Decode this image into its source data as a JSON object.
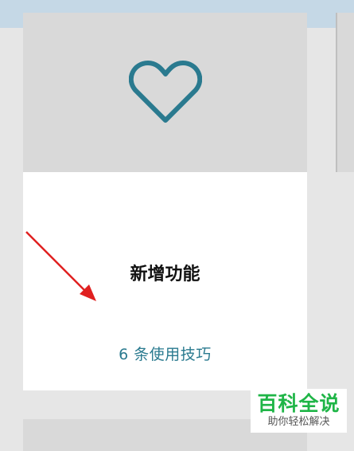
{
  "card": {
    "icon": "heart-outline-icon",
    "title": "新增功能",
    "link": "6 条使用技巧"
  },
  "colors": {
    "accent": "#2a7a8f",
    "hero_bg": "#d9d9d9",
    "arrow": "#e02020",
    "watermark": "#1fb547"
  },
  "watermark": {
    "main": "百科全说",
    "sub": "助你轻松解决"
  }
}
